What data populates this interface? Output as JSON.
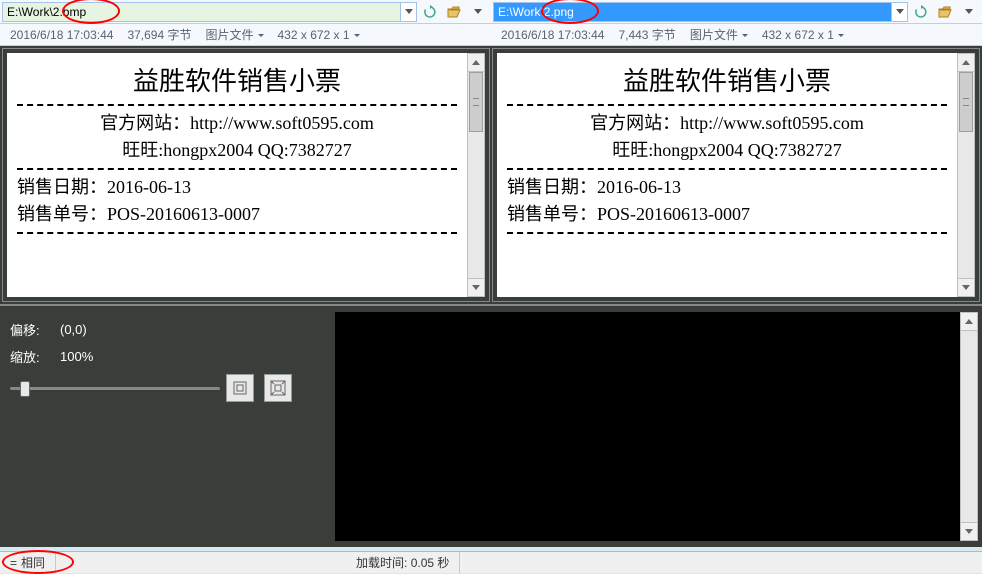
{
  "left": {
    "path": "E:\\Work\\2.bmp",
    "date": "2016/6/18 17:03:44",
    "size": "37,694 字节",
    "type_label": "图片文件",
    "dimensions": "432 x 672 x 1"
  },
  "right": {
    "path": "E:\\Work\\2.png",
    "date": "2016/6/18 17:03:44",
    "size": "7,443 字节",
    "type_label": "图片文件",
    "dimensions": "432 x 672 x 1"
  },
  "ticket": {
    "title": "益胜软件销售小票",
    "website_line": "官方网站：http://www.soft0595.com",
    "contact_line": "旺旺:hongpx2004 QQ:7382727",
    "sale_date": "销售日期：2016-06-13",
    "sale_no": "销售单号：POS-20160613-0007"
  },
  "controls": {
    "offset_label": "偏移:",
    "offset_value": "(0,0)",
    "zoom_label": "缩放:",
    "zoom_value": "100%"
  },
  "status": {
    "equal_symbol": "=",
    "equal_text": "相同",
    "load_time": "加载时间: 0.05 秒"
  }
}
